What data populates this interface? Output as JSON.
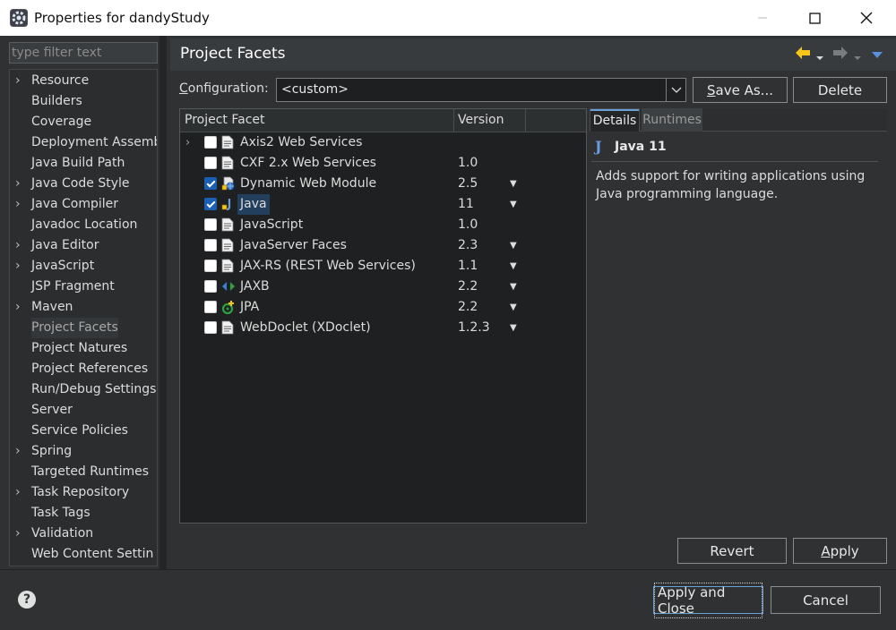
{
  "window": {
    "title": "Properties for dandyStudy",
    "minimize": "—",
    "maximize": "☐",
    "close": "✕"
  },
  "nav": {
    "filter_placeholder": "type filter text",
    "items": [
      {
        "label": "Resource",
        "expandable": true
      },
      {
        "label": "Builders",
        "expandable": false
      },
      {
        "label": "Coverage",
        "expandable": false
      },
      {
        "label": "Deployment Assemb",
        "expandable": false
      },
      {
        "label": "Java Build Path",
        "expandable": false
      },
      {
        "label": "Java Code Style",
        "expandable": true
      },
      {
        "label": "Java Compiler",
        "expandable": true
      },
      {
        "label": "Javadoc Location",
        "expandable": false
      },
      {
        "label": "Java Editor",
        "expandable": true
      },
      {
        "label": "JavaScript",
        "expandable": true
      },
      {
        "label": "JSP Fragment",
        "expandable": false
      },
      {
        "label": "Maven",
        "expandable": true
      },
      {
        "label": "Project Facets",
        "expandable": false,
        "selected": true
      },
      {
        "label": "Project Natures",
        "expandable": false
      },
      {
        "label": "Project References",
        "expandable": false
      },
      {
        "label": "Run/Debug Settings",
        "expandable": false
      },
      {
        "label": "Server",
        "expandable": false
      },
      {
        "label": "Service Policies",
        "expandable": false
      },
      {
        "label": "Spring",
        "expandable": true
      },
      {
        "label": "Targeted Runtimes",
        "expandable": false
      },
      {
        "label": "Task Repository",
        "expandable": true
      },
      {
        "label": "Task Tags",
        "expandable": false
      },
      {
        "label": "Validation",
        "expandable": true
      },
      {
        "label": "Web Content Settin",
        "expandable": false
      }
    ]
  },
  "page": {
    "title": "Project Facets"
  },
  "configuration": {
    "label": "Configuration:",
    "value": "<custom>",
    "save_as": "Save As...",
    "delete": "Delete"
  },
  "facets": {
    "col_facet": "Project Facet",
    "col_version": "Version",
    "rows": [
      {
        "name": "Axis2 Web Services",
        "version": "",
        "checked": false,
        "expandable": true,
        "icon": "doc-icon",
        "dropdown": false
      },
      {
        "name": "CXF 2.x Web Services",
        "version": "1.0",
        "checked": false,
        "expandable": false,
        "icon": "doc-icon",
        "dropdown": false
      },
      {
        "name": "Dynamic Web Module",
        "version": "2.5",
        "checked": true,
        "expandable": false,
        "icon": "web-module-icon",
        "dropdown": true
      },
      {
        "name": "Java",
        "version": "11",
        "checked": true,
        "expandable": false,
        "icon": "java-icon",
        "dropdown": true,
        "selected": true
      },
      {
        "name": "JavaScript",
        "version": "1.0",
        "checked": false,
        "expandable": false,
        "icon": "doc-icon",
        "dropdown": false
      },
      {
        "name": "JavaServer Faces",
        "version": "2.3",
        "checked": false,
        "expandable": false,
        "icon": "doc-icon",
        "dropdown": true
      },
      {
        "name": "JAX-RS (REST Web Services)",
        "version": "1.1",
        "checked": false,
        "expandable": false,
        "icon": "doc-icon",
        "dropdown": true
      },
      {
        "name": "JAXB",
        "version": "2.2",
        "checked": false,
        "expandable": false,
        "icon": "jaxb-icon",
        "dropdown": true
      },
      {
        "name": "JPA",
        "version": "2.2",
        "checked": false,
        "expandable": false,
        "icon": "jpa-icon",
        "dropdown": true
      },
      {
        "name": "WebDoclet (XDoclet)",
        "version": "1.2.3",
        "checked": false,
        "expandable": false,
        "icon": "doc-icon",
        "dropdown": true
      }
    ]
  },
  "details": {
    "tab_details": "Details",
    "tab_runtimes": "Runtimes",
    "icon": "J",
    "title": "Java 11",
    "description": "Adds support for writing applications using Java programming language."
  },
  "buttons": {
    "revert": "Revert",
    "apply": "Apply",
    "apply_close": "Apply and Close",
    "cancel": "Cancel",
    "help": "?"
  },
  "colors": {
    "accent": "#1a5fb4",
    "back_arrow": "#f5c518",
    "focus": "#6aa0d8"
  }
}
